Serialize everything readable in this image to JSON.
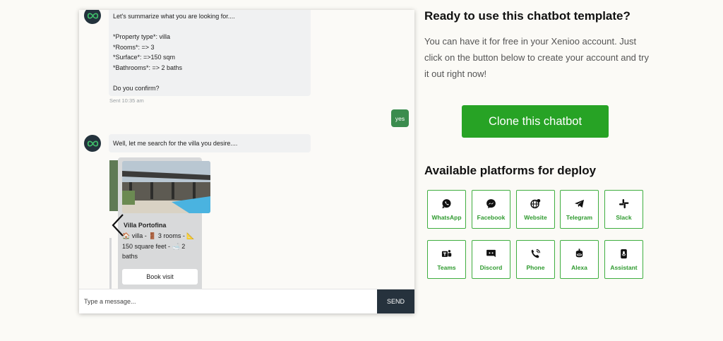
{
  "chat": {
    "bot_message_1": [
      "Let's summarize what you are looking for....",
      "",
      "*Property type*: villa",
      "*Rooms*: => 3",
      "*Surface*: =>150 sqm",
      "*Bathrooms*: => 2 baths",
      "",
      "Do you confirm?"
    ],
    "sent_time": "Sent 10:35 am",
    "user_reply": "yes",
    "bot_message_2": "Well, let me search for the villa you desire....",
    "card": {
      "title": "Villa Portofina",
      "description": "🏠 villa - 🚪 3 rooms - 📐 150 square feet - 🛁 2 baths",
      "button": "Book visit"
    },
    "input_placeholder": "Type a message...",
    "send_label": "SEND",
    "colors": {
      "avatar": "#24333d",
      "user_bubble": "#3b8c4e",
      "send_button": "#26323d"
    }
  },
  "panel": {
    "title": "Ready to use this chatbot template?",
    "description": "You can have it for free in your Xenioo account. Just click on the button below to create your account and try it out right now!",
    "clone_button": "Clone this chatbot",
    "platforms_title": "Available platforms for deploy",
    "platforms": [
      {
        "label": "WhatsApp",
        "icon": "whatsapp-icon"
      },
      {
        "label": "Facebook",
        "icon": "messenger-icon"
      },
      {
        "label": "Website",
        "icon": "website-icon"
      },
      {
        "label": "Telegram",
        "icon": "telegram-icon"
      },
      {
        "label": "Slack",
        "icon": "slack-icon"
      },
      {
        "label": "Teams",
        "icon": "teams-icon"
      },
      {
        "label": "Discord",
        "icon": "discord-icon"
      },
      {
        "label": "Phone",
        "icon": "phone-icon"
      },
      {
        "label": "Alexa",
        "icon": "alexa-icon"
      },
      {
        "label": "Assistant",
        "icon": "assistant-icon"
      }
    ],
    "colors": {
      "clone_button": "#27a325",
      "platform_border": "#3fae3f",
      "platform_label": "#2f9a2f"
    }
  }
}
